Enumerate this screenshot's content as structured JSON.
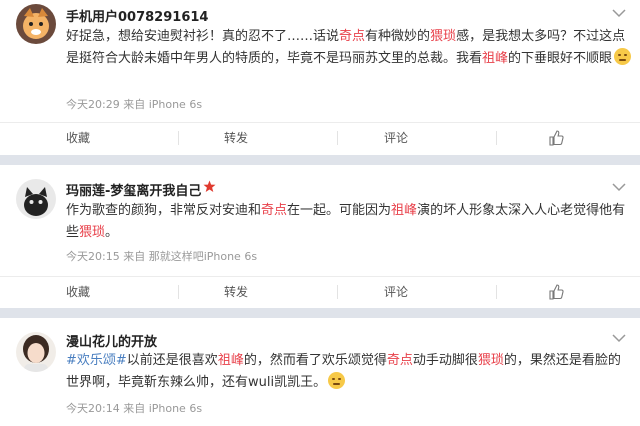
{
  "posts": [
    {
      "username": "手机用户0078291614",
      "segments": [
        {
          "t": "好捉急，想给安迪熨衬衫！真的忍不了……话说"
        },
        {
          "t": "奇点",
          "h": true
        },
        {
          "t": "有种微妙的"
        },
        {
          "t": "猥琐",
          "h": true
        },
        {
          "t": "感，是我想太多吗？不过这点是挺符合大龄未婚中年男人的特质的，毕竟不是玛丽苏文里的总裁。我看"
        },
        {
          "t": "祖峰",
          "h": true
        },
        {
          "t": "的下垂眼好不顺眼"
        }
      ],
      "meta": "今天20:29 来自 iPhone 6s",
      "actions": {
        "favorite": "收藏",
        "repost": "转发",
        "comment": "评论"
      }
    },
    {
      "username": "玛丽莲-梦玺离开我自己",
      "segments": [
        {
          "t": "作为歌查的颜狗，非常反对安迪和"
        },
        {
          "t": "奇点",
          "h": true
        },
        {
          "t": "在一起。可能因为"
        },
        {
          "t": "祖峰",
          "h": true
        },
        {
          "t": "演的坏人形象太深入人心老觉得他有些"
        },
        {
          "t": "猥琐",
          "h": true
        },
        {
          "t": "。"
        }
      ],
      "meta": "今天20:15 来自 那就这样吧iPhone 6s",
      "actions": {
        "favorite": "收藏",
        "repost": "转发",
        "comment": "评论"
      }
    },
    {
      "username": "漫山花儿的开放",
      "segments": [
        {
          "t": "#欢乐颂#",
          "tag": true
        },
        {
          "t": "以前还是很喜欢"
        },
        {
          "t": "祖峰",
          "h": true
        },
        {
          "t": "的，然而看了欢乐颂觉得"
        },
        {
          "t": "奇点",
          "h": true
        },
        {
          "t": "动手动脚很"
        },
        {
          "t": "猥琐",
          "h": true
        },
        {
          "t": "的，果然还是看脸的世界啊，毕竟靳东辣么帅，还有wuli凯凯王。"
        }
      ],
      "meta": "今天20:14 来自 iPhone 6s",
      "actions": {}
    }
  ],
  "colors": {
    "highlight": "#e8404a",
    "topic": "#4a7fc0",
    "separator": "#dfe3ea"
  },
  "icons": {
    "avatar1": "cartoon-avatar",
    "avatar2": "cat-avatar",
    "avatar3": "photo-avatar",
    "verified": "red-star-icon",
    "emoji": "smile-emoji"
  }
}
